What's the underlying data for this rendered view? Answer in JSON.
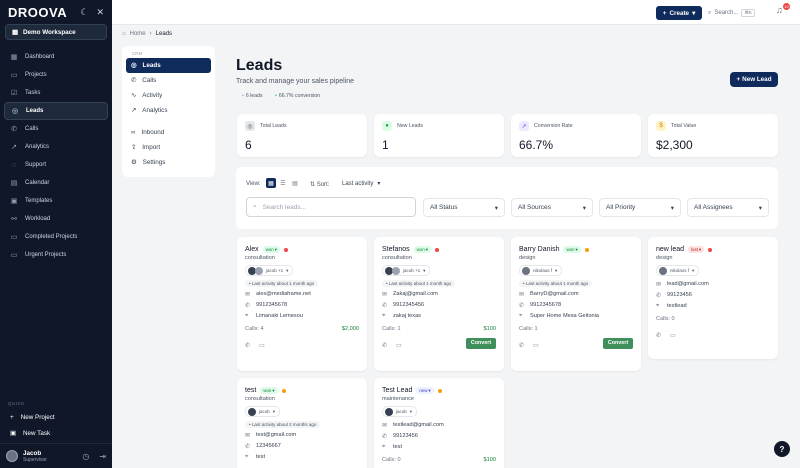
{
  "app": {
    "logo": "DROOVA",
    "theme_icon": "moon-icon",
    "collapse_icon": "close-icon"
  },
  "sidebar": {
    "workspace": "Demo Workspace",
    "items": [
      {
        "label": "Dashboard",
        "icon": "dashboard-icon"
      },
      {
        "label": "Projects",
        "icon": "folder-icon"
      },
      {
        "label": "Tasks",
        "icon": "tasks-icon"
      },
      {
        "label": "Leads",
        "icon": "leads-icon",
        "active": true
      },
      {
        "label": "Calls",
        "icon": "phone-icon"
      },
      {
        "label": "Analytics",
        "icon": "analytics-icon"
      },
      {
        "label": "Support",
        "icon": "support-icon"
      },
      {
        "label": "Calendar",
        "icon": "calendar-icon"
      },
      {
        "label": "Templates",
        "icon": "templates-icon"
      },
      {
        "label": "Workload",
        "icon": "workload-icon"
      },
      {
        "label": "Completed Projects",
        "icon": "check-folder-icon"
      },
      {
        "label": "Urgent Projects",
        "icon": "urgent-folder-icon"
      }
    ],
    "quick_title": "QUICK",
    "quick": [
      {
        "label": "New Project"
      },
      {
        "label": "New Task"
      }
    ],
    "user": {
      "name": "Jacob",
      "role": "Supervisor"
    }
  },
  "topbar": {
    "create_label": "Create",
    "search_placeholder": "Search...",
    "shortcut": "⌘K",
    "notifications": "10"
  },
  "breadcrumb": {
    "home": "Home",
    "current": "Leads"
  },
  "subnav": {
    "title": "CRM",
    "items": [
      {
        "label": "Leads",
        "active": true
      },
      {
        "label": "Calls"
      },
      {
        "label": "Activity"
      },
      {
        "label": "Analytics"
      },
      {
        "label": "Inbound"
      },
      {
        "label": "Import"
      },
      {
        "label": "Settings"
      }
    ]
  },
  "page": {
    "title": "Leads",
    "subtitle": "Track and manage your sales pipeline",
    "count_chip": "6 leads",
    "conversion_chip": "66.7% conversion",
    "new_lead_label": "New Lead"
  },
  "stats": [
    {
      "label": "Total Leads",
      "value": "6",
      "color": "#e5e7eb"
    },
    {
      "label": "New Leads",
      "value": "1",
      "color": "#dcfce7"
    },
    {
      "label": "Conversion Rate",
      "value": "66.7%",
      "color": "#ede9fe"
    },
    {
      "label": "Total Value",
      "value": "$2,300",
      "color": "#fef3c7"
    }
  ],
  "filters": {
    "view_label": "View:",
    "sort_label": "Sort:",
    "sort_value": "Last activity",
    "search_placeholder": "Search leads...",
    "selects": [
      "All Status",
      "All Sources",
      "All Priority",
      "All Assignees"
    ]
  },
  "leads": [
    {
      "name": "Alex",
      "status": "won",
      "priority_color": "#ef4444",
      "type": "consultation",
      "assignee": "jacob +1",
      "activity": "Last activity about 1 month ago",
      "email": "alex@mediaframe.net",
      "phone": "9912345678",
      "location": "Limanaki Lemesou",
      "calls": "Calls: 4",
      "amount": "$2,000",
      "convert": ""
    },
    {
      "name": "Stefanos",
      "status": "won",
      "priority_color": "#ef4444",
      "type": "consultation",
      "assignee": "jacob +1",
      "activity": "Last activity about 1 month ago",
      "email": "Zakaj@gmail.com",
      "phone": "9912345456",
      "location": "zakaj texas",
      "calls": "Calls: 1",
      "amount": "$100",
      "convert": "Convert"
    },
    {
      "name": "Barry Danish",
      "status": "won",
      "priority_color": "#f59e0b",
      "type": "design",
      "assignee": "nikolaos f",
      "activity": "Last activity about 1 month ago",
      "email": "BarryD@gmail.com",
      "phone": "9912345678",
      "location": "Super Home Mesa Geitonia",
      "calls": "Calls: 1",
      "amount": "",
      "convert": "Convert"
    },
    {
      "name": "new lead",
      "status": "lost",
      "priority_color": "#ef4444",
      "type": "design",
      "assignee": "nikolaos f",
      "activity": "",
      "email": "lead@gmail.com",
      "phone": "99123456",
      "location": "testlead",
      "calls": "Calls: 0",
      "amount": "",
      "convert": ""
    },
    {
      "name": "test",
      "status": "won",
      "priority_color": "#f59e0b",
      "type": "consultation",
      "assignee": "jacob",
      "activity": "Last activity about 2 months ago",
      "email": "test@gmail.com",
      "phone": "12345667",
      "location": "test",
      "calls": "",
      "amount": "",
      "convert": ""
    },
    {
      "name": "Test Lead",
      "status": "new",
      "priority_color": "#f59e0b",
      "type": "maintenance",
      "assignee": "jacob",
      "activity": "",
      "email": "testlead@gmail.com",
      "phone": "99123456",
      "location": "test",
      "calls": "Calls: 0",
      "amount": "$100",
      "convert": ""
    }
  ]
}
